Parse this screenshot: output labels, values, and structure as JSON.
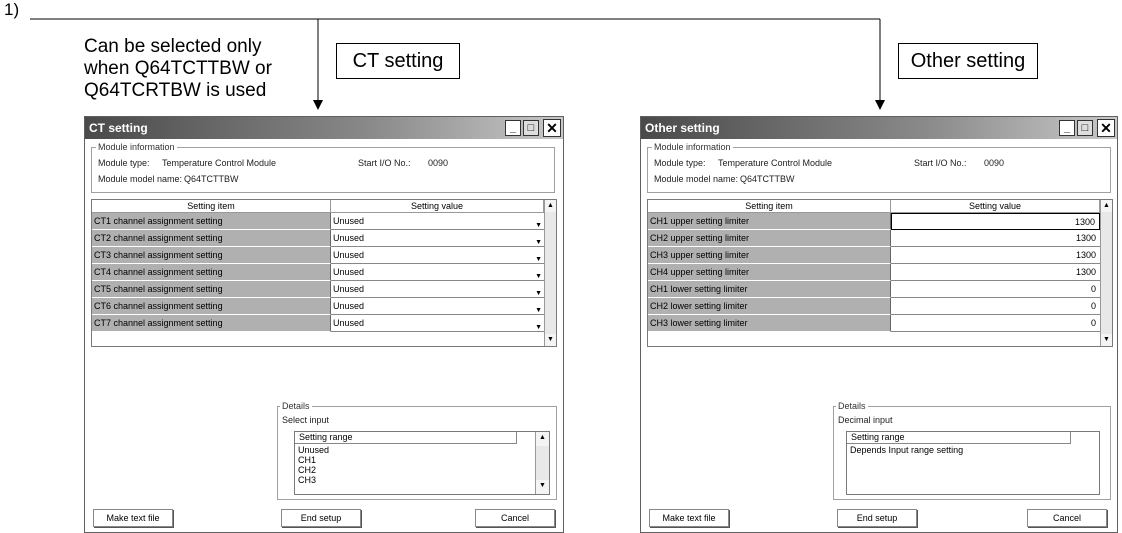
{
  "callout": {
    "number": "1)",
    "note_lines": [
      "Can be selected only",
      "when Q64TCTTBW or",
      "Q64TCRTBW is used"
    ],
    "ct_label": "CT setting",
    "other_label": "Other setting"
  },
  "ct_window": {
    "title": "CT setting",
    "module_info": {
      "group_label": "Module information",
      "type_label": "Module type:",
      "type_value": "Temperature Control Module",
      "model_label": "Module model name:",
      "model_value": "Q64TCTTBW",
      "io_label": "Start I/O No.:",
      "io_value": "0090"
    },
    "grid": {
      "col_item": "Setting item",
      "col_value": "Setting value",
      "rows": [
        {
          "item": "CT1 channel assignment setting",
          "value": "Unused"
        },
        {
          "item": "CT2 channel assignment setting",
          "value": "Unused"
        },
        {
          "item": "CT3 channel assignment setting",
          "value": "Unused"
        },
        {
          "item": "CT4 channel assignment setting",
          "value": "Unused"
        },
        {
          "item": "CT5 channel assignment setting",
          "value": "Unused"
        },
        {
          "item": "CT6 channel assignment setting",
          "value": "Unused"
        },
        {
          "item": "CT7 channel assignment setting",
          "value": "Unused"
        }
      ]
    },
    "details": {
      "group_label": "Details",
      "input_type": "Select input",
      "range_header": "Setting range",
      "options": [
        "Unused",
        "CH1",
        "CH2",
        "CH3"
      ]
    },
    "buttons": {
      "text_file": "Make text file",
      "end": "End setup",
      "cancel": "Cancel"
    }
  },
  "other_window": {
    "title": "Other setting",
    "module_info": {
      "group_label": "Module information",
      "type_label": "Module type:",
      "type_value": "Temperature Control Module",
      "model_label": "Module model name:",
      "model_value": "Q64TCTTBW",
      "io_label": "Start I/O No.:",
      "io_value": "0090"
    },
    "grid": {
      "col_item": "Setting item",
      "col_value": "Setting value",
      "rows": [
        {
          "item": "CH1 upper setting limiter",
          "value": "1300"
        },
        {
          "item": "CH2 upper setting limiter",
          "value": "1300"
        },
        {
          "item": "CH3 upper setting limiter",
          "value": "1300"
        },
        {
          "item": "CH4 upper setting limiter",
          "value": "1300"
        },
        {
          "item": "CH1 lower setting limiter",
          "value": "0"
        },
        {
          "item": "CH2 lower setting limiter",
          "value": "0"
        },
        {
          "item": "CH3 lower setting limiter",
          "value": "0"
        }
      ]
    },
    "details": {
      "group_label": "Details",
      "input_type": "Decimal input",
      "range_header": "Setting range",
      "options": [
        "Depends Input range setting"
      ]
    },
    "buttons": {
      "text_file": "Make text file",
      "end": "End setup",
      "cancel": "Cancel"
    }
  }
}
